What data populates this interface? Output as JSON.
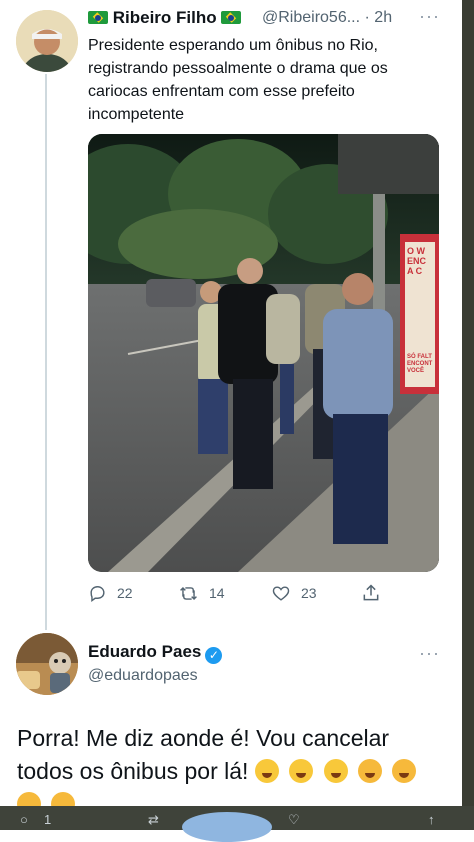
{
  "tweet": {
    "author_name": "Ribeiro Filho",
    "handle": "@Ribeiro56...",
    "time": "· 2h",
    "text": "Presidente esperando um ônibus no Rio, registrando pessoalmente o drama que os cariocas enfrentam com esse prefeito incompetente",
    "actions": {
      "reply_count": "22",
      "retweet_count": "14",
      "like_count": "23"
    },
    "photo_sign_text": [
      "O W",
      "ENC",
      "A C",
      "SÓ FALT",
      "ENCONT",
      "VOCÊ"
    ]
  },
  "reply": {
    "author_name": "Eduardo Paes",
    "handle": "@eduardopaes",
    "text": "Porra!  Me diz aonde é!  Vou cancelar todos os ônibus por lá!",
    "emoji_count": 7
  },
  "bottom_bar": {
    "reply_count": "1"
  }
}
